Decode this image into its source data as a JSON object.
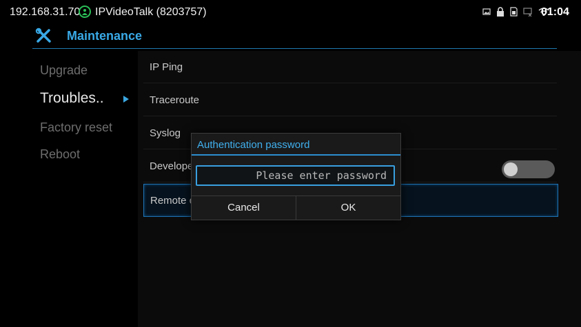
{
  "status_bar": {
    "ip": "192.168.31.70",
    "account": "IPVideoTalk (8203757)",
    "clock": "01:04",
    "icons": [
      "screenshot-icon",
      "lock-icon",
      "sim-icon",
      "ethernet-off-icon",
      "wifi-icon"
    ]
  },
  "header": {
    "title": "Maintenance",
    "icon": "tools-icon"
  },
  "nav": {
    "items": [
      {
        "label": "Upgrade"
      },
      {
        "label": "Troubles.."
      },
      {
        "label": "Factory reset"
      },
      {
        "label": "Reboot"
      }
    ]
  },
  "settings": {
    "rows": [
      {
        "label": "IP Ping"
      },
      {
        "label": "Traceroute"
      },
      {
        "label": "Syslog"
      },
      {
        "label": "Developer mode",
        "toggle": "off"
      },
      {
        "label": "Remote diagnosis"
      }
    ]
  },
  "dialog": {
    "title": "Authentication password",
    "placeholder": "Please enter password",
    "cancel_label": "Cancel",
    "ok_label": "OK"
  },
  "colors": {
    "accent": "#39a9e6",
    "background": "#000000",
    "contact_badge": "#2bbf57"
  }
}
